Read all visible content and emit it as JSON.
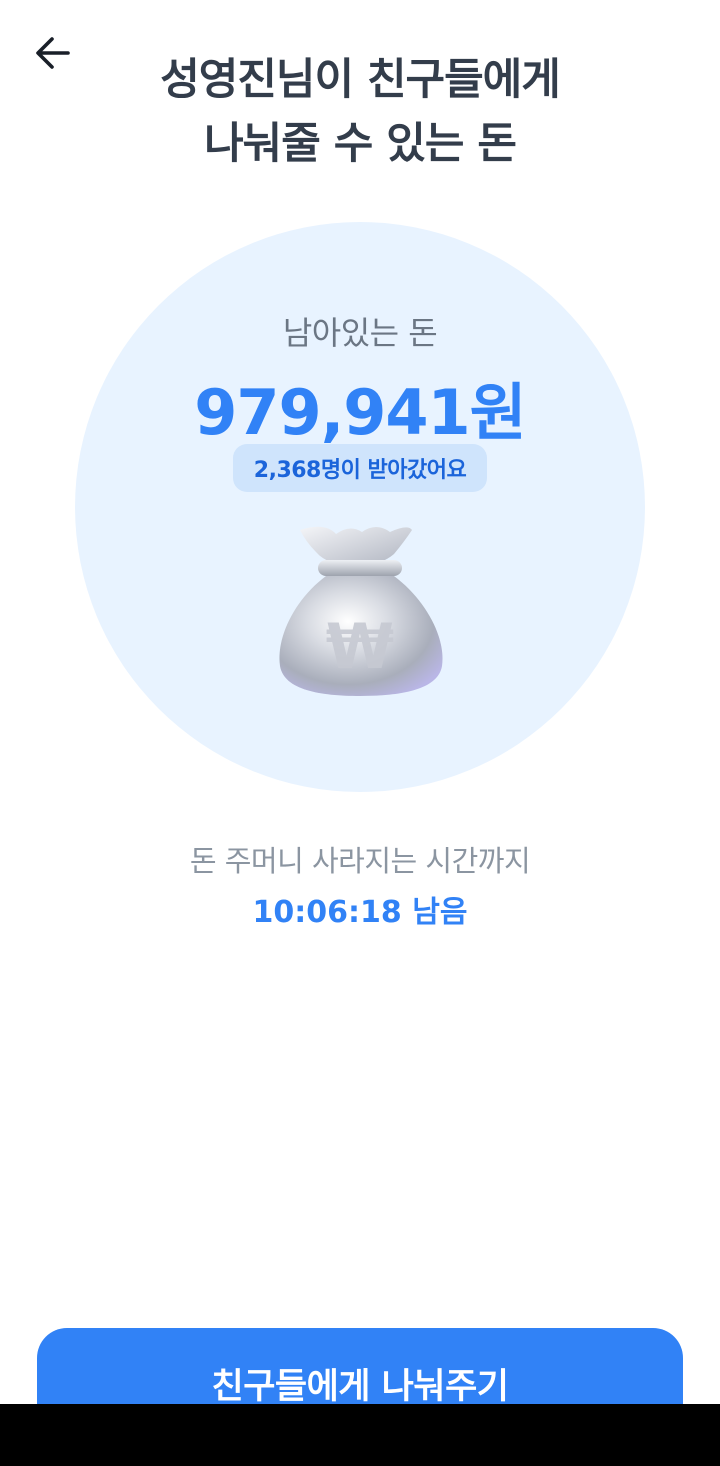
{
  "header": {
    "back_icon": "arrow-left-icon",
    "title_line1": "성영진님이 친구들에게",
    "title_line2": "나눠줄 수 있는 돈"
  },
  "summary": {
    "remaining_label": "남아있는 돈",
    "amount": "979,941원",
    "recipients_badge": "2,368명이 받아갔어요",
    "illustration": "money-bag-icon"
  },
  "timer": {
    "label": "돈 주머니 사라지는 시간까지",
    "value": "10:06:18 남음"
  },
  "cta": {
    "label": "친구들에게 나눠주기"
  },
  "colors": {
    "accent": "#3182f6",
    "circle_bg": "#e8f3ff",
    "badge_bg": "#cfe4fc",
    "title": "#333d4b",
    "muted": "#8b95a1"
  }
}
